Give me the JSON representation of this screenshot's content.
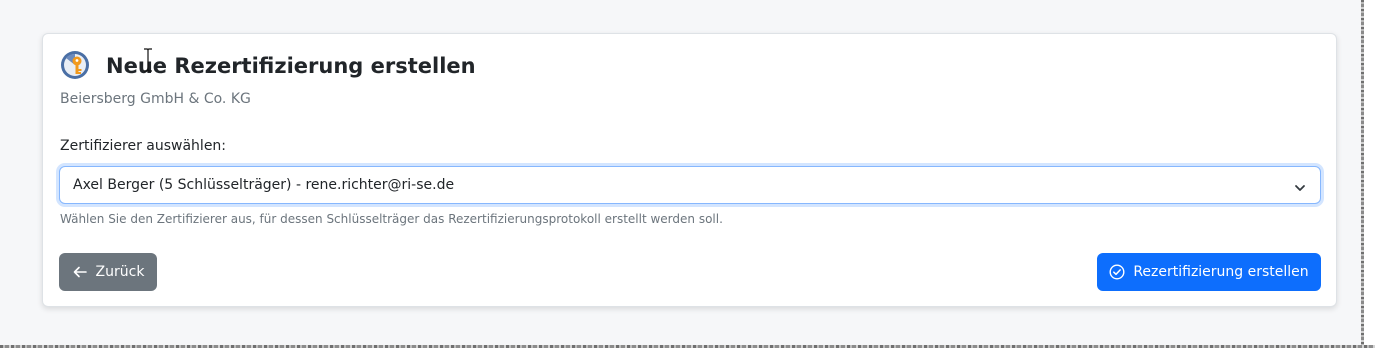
{
  "card": {
    "title": "Neue Rezertifizierung erstellen",
    "subtitle": "Beiersberg GmbH & Co. KG"
  },
  "form": {
    "select_label": "Zertifizierer auswählen:",
    "selected_value": "Axel Berger (5 Schlüsselträger) - rene.richter@ri-se.de",
    "help_text": "Wählen Sie den Zertifizierer aus, für dessen Schlüsselträger das Rezertifizierungsprotokoll erstellt werden soll."
  },
  "actions": {
    "back_label": "Zurück",
    "create_label": "Rezertifizierung erstellen"
  },
  "icons": {
    "logo": "key-logo-icon",
    "select_arrow": "chevron-down-icon",
    "back": "arrow-left-icon",
    "create": "check-circle-icon"
  },
  "colors": {
    "primary": "#0d6efd",
    "secondary": "#6c757d",
    "focus_border": "#86b7fe"
  }
}
